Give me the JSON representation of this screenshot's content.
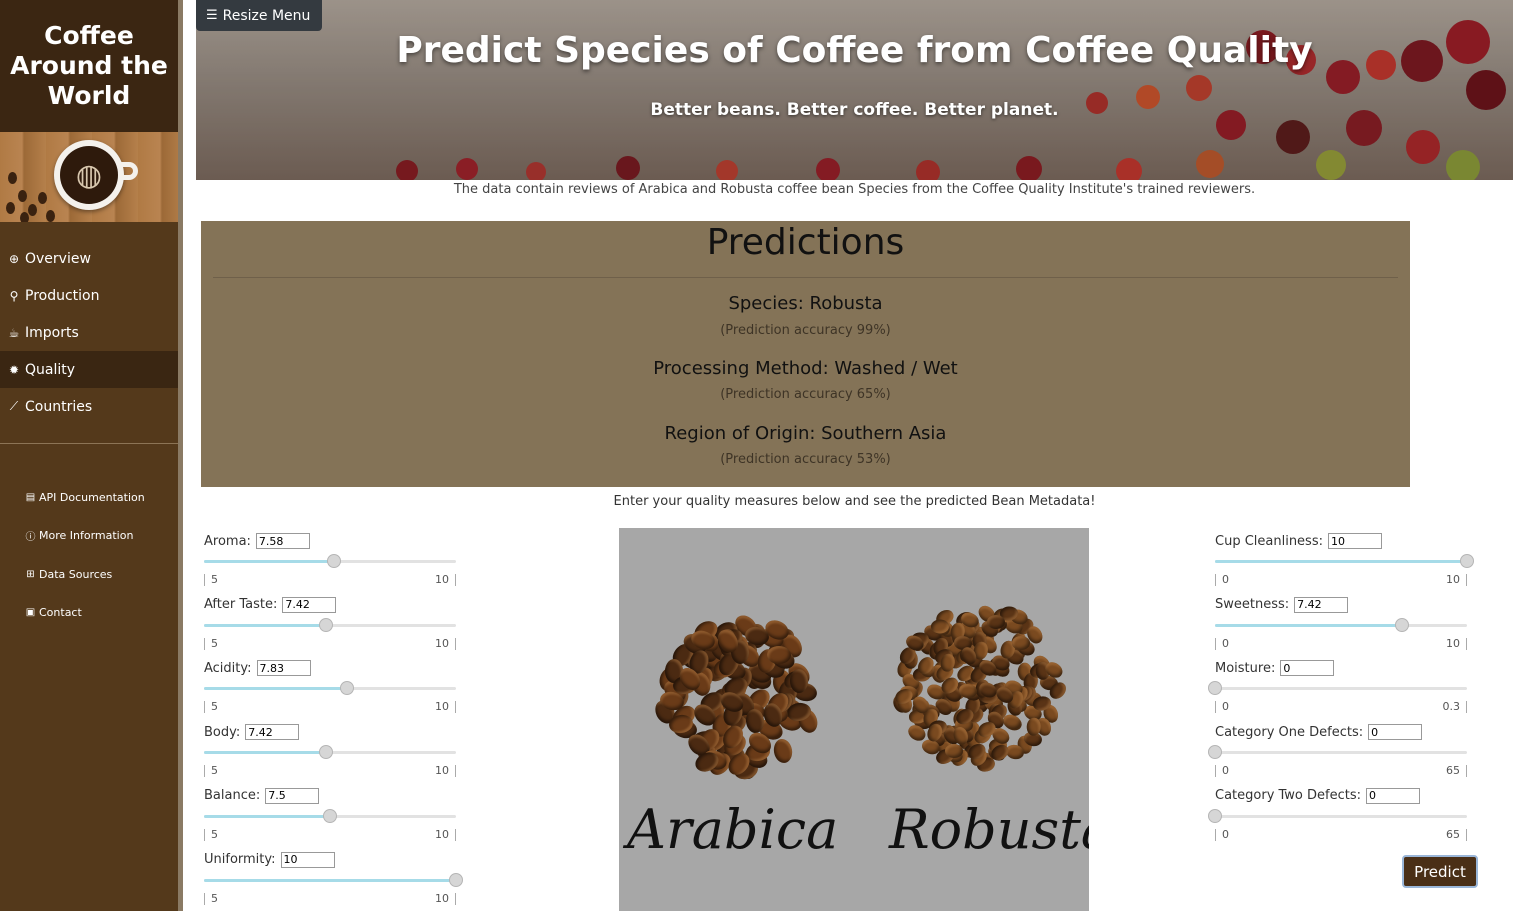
{
  "sidebar": {
    "brand": "Coffee Around the World",
    "nav": [
      {
        "label": "Overview",
        "icon": "globe-icon"
      },
      {
        "label": "Production",
        "icon": "seedling-icon"
      },
      {
        "label": "Imports",
        "icon": "mug-icon"
      },
      {
        "label": "Quality",
        "icon": "cog-icon",
        "active": true
      },
      {
        "label": "Countries",
        "icon": "chart-line-icon"
      }
    ],
    "links": [
      {
        "label": "API Documentation",
        "icon": "file-icon"
      },
      {
        "label": "More Information",
        "icon": "info-icon"
      },
      {
        "label": "Data Sources",
        "icon": "table-icon"
      },
      {
        "label": "Contact",
        "icon": "id-card-icon"
      }
    ]
  },
  "header": {
    "resize_label": "Resize Menu",
    "title": "Predict Species of Coffee from Coffee Quality",
    "subtitle": "Better beans. Better coffee. Better planet.",
    "caption": "The data contain reviews of Arabica and Robusta coffee bean Species from the Coffee Quality Institute's trained reviewers."
  },
  "predictions": {
    "title": "Predictions",
    "species": "Species: Robusta",
    "species_acc": "(Prediction accuracy 99%)",
    "method": "Processing Method: Washed / Wet",
    "method_acc": "(Prediction accuracy 65%)",
    "region": "Region of Origin: Southern Asia",
    "region_acc": "(Prediction accuracy 53%)"
  },
  "instructions": "Enter your quality measures below and see the predicted Bean Metadata!",
  "left_sliders": [
    {
      "label": "Aroma:",
      "value": "7.58",
      "min": "5",
      "max": "10",
      "frac": 0.516
    },
    {
      "label": "After Taste:",
      "value": "7.42",
      "min": "5",
      "max": "10",
      "frac": 0.484
    },
    {
      "label": "Acidity:",
      "value": "7.83",
      "min": "5",
      "max": "10",
      "frac": 0.566
    },
    {
      "label": "Body:",
      "value": "7.42",
      "min": "5",
      "max": "10",
      "frac": 0.484
    },
    {
      "label": "Balance:",
      "value": "7.5",
      "min": "5",
      "max": "10",
      "frac": 0.5
    },
    {
      "label": "Uniformity:",
      "value": "10",
      "min": "5",
      "max": "10",
      "frac": 1.0
    }
  ],
  "right_sliders": [
    {
      "label": "Cup Cleanliness:",
      "value": "10",
      "min": "0",
      "max": "10",
      "frac": 1.0
    },
    {
      "label": "Sweetness:",
      "value": "7.42",
      "min": "0",
      "max": "10",
      "frac": 0.742
    },
    {
      "label": "Moisture:",
      "value": "0",
      "min": "0",
      "max": "0.3",
      "frac": 0.0
    },
    {
      "label": "Category One Defects:",
      "value": "0",
      "min": "0",
      "max": "65",
      "frac": 0.0
    },
    {
      "label": "Category Two Defects:",
      "value": "0",
      "min": "0",
      "max": "65",
      "frac": 0.0
    }
  ],
  "beans_image": {
    "left_label": "Arabica",
    "right_label": "Robusta"
  },
  "predict_label": "Predict",
  "colors": {
    "sidebar": "#54391b",
    "brand": "#3b2612",
    "predictions_bg": "#847357",
    "accent_fill": "#a6dbe8",
    "button": "#4a2f16"
  }
}
